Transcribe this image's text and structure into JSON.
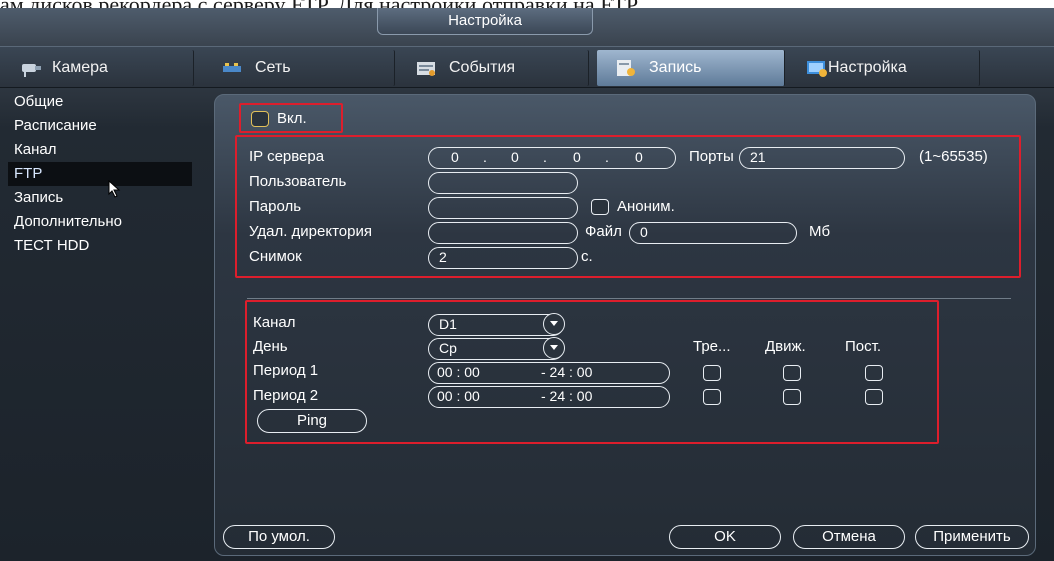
{
  "fragment_text": "ам дисков рекордера с серверу FTP. Для настройки отправки на FTP",
  "window_title": "Настройка",
  "tabs": [
    {
      "label": "Камера"
    },
    {
      "label": "Сеть"
    },
    {
      "label": "События"
    },
    {
      "label": "Запись"
    },
    {
      "label": "Настройка"
    }
  ],
  "active_tab": "Запись",
  "sidebar": {
    "items": [
      {
        "label": "Общие"
      },
      {
        "label": "Расписание"
      },
      {
        "label": "Канал"
      },
      {
        "label": "FTP"
      },
      {
        "label": "Запись"
      },
      {
        "label": "Дополнительно"
      },
      {
        "label": "ТЕСТ HDD"
      }
    ],
    "active": "FTP"
  },
  "ftp": {
    "enable_label": "Вкл.",
    "server_ip_label": "IP сервера",
    "server_ip": [
      "0",
      "0",
      "0",
      "0"
    ],
    "port_label": "Порты",
    "port_value": "21",
    "port_range": "(1~65535)",
    "user_label": "Пользователь",
    "user_value": "",
    "password_label": "Пароль",
    "password_value": "",
    "anon_label": "Аноним.",
    "remote_dir_label": "Удал. директория",
    "remote_dir_value": "",
    "file_label": "Файл",
    "file_value": "0",
    "file_unit": "Мб",
    "snapshot_label": "Снимок",
    "snapshot_value": "2",
    "snapshot_unit": "с."
  },
  "schedule": {
    "channel_label": "Канал",
    "channel_value": "D1",
    "day_label": "День",
    "day_value": "Ср",
    "col_alarm": "Тре...",
    "col_motion": "Движ.",
    "col_const": "Пост.",
    "periods": [
      {
        "label": "Период 1",
        "start": "00 : 00",
        "end": "- 24 : 00"
      },
      {
        "label": "Период 2",
        "start": "00 : 00",
        "end": "- 24 : 00"
      }
    ],
    "ping_label": "Ping"
  },
  "buttons": {
    "default": "По умол.",
    "ok": "OK",
    "cancel": "Отмена",
    "apply": "Применить"
  },
  "colors": {
    "highlight_box": "#dd1e2c",
    "active_tab": "#7d97b4",
    "enable_checkbox": "#e1c05a"
  }
}
